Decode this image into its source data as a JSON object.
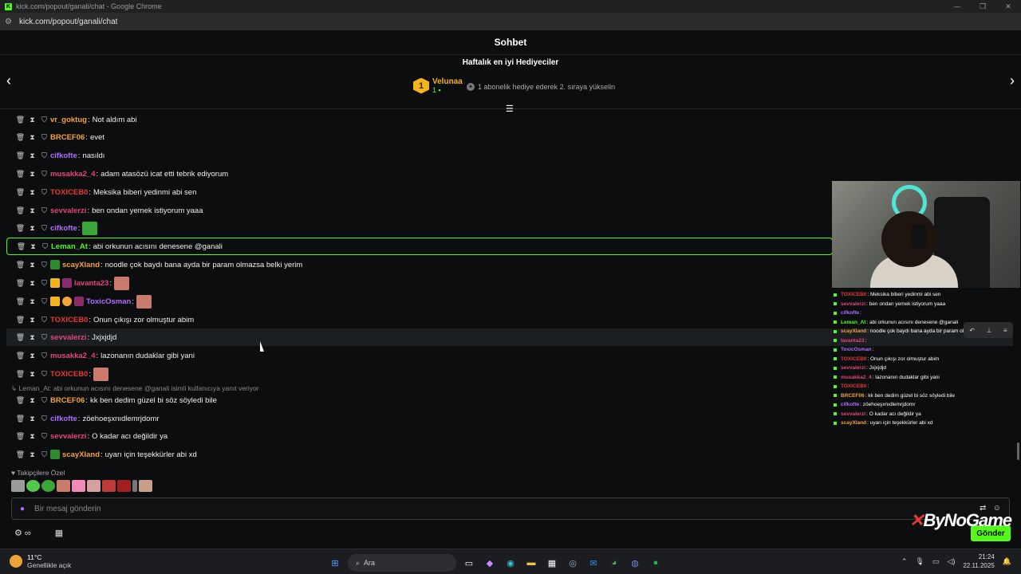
{
  "browser": {
    "title": "kick.com/popout/ganali/chat - Google Chrome",
    "url": "kick.com/popout/ganali/chat"
  },
  "header": {
    "title": "Sohbet"
  },
  "gifters": {
    "title": "Haftalık en iyi Hediyeciler",
    "top": {
      "rank": "1",
      "name": "Velunaa",
      "count": "1"
    },
    "hint": "1 abonelik hediye ederek 2. sıraya yükselin"
  },
  "messages": [
    {
      "user": "vr_goktug",
      "color": "#f3a33a",
      "text": "Not aldım abi"
    },
    {
      "user": "BRCEF06",
      "color": "#f3a33a",
      "text": "evet"
    },
    {
      "user": "cifkofte",
      "color": "#b36cff",
      "text": "nasıldı"
    },
    {
      "user": "musakka2_4",
      "color": "#e5457a",
      "text": "adam atasözü icat etti tebrik ediyorum"
    },
    {
      "user": "TOXICEB0",
      "color": "#e53935",
      "text": "Meksika biberi yedinmi abi sen"
    },
    {
      "user": "sevvalerzi",
      "color": "#e5457a",
      "text": "ben ondan yemek istiyorum yaaa"
    },
    {
      "user": "cifkofte",
      "color": "#b36cff",
      "text": ""
    },
    {
      "user": "Leman_At",
      "color": "#53fc18",
      "text": "abi orkunun acısını denesene @ganali"
    },
    {
      "user": "scayXland",
      "color": "#f3a33a",
      "text": "noodle çok baydı bana ayda bir param olmazsa belki yerim"
    },
    {
      "user": "lavanta23",
      "color": "#e5457a",
      "text": ""
    },
    {
      "user": "ToxicOsman",
      "color": "#b36cff",
      "text": ""
    },
    {
      "user": "TOXICEB0",
      "color": "#e53935",
      "text": "Onun çıkışı zor olmuştur abim"
    },
    {
      "user": "sevvalerzi",
      "color": "#e5457a",
      "text": "Jxjxjdjd"
    },
    {
      "user": "musakka2_4",
      "color": "#e5457a",
      "text": "lazonanın dudaklar gibi yani"
    },
    {
      "user": "TOXICEB0",
      "color": "#e53935",
      "text": ""
    },
    {
      "user": "BRCEF06",
      "color": "#f3a33a",
      "text": "kk ben dedim güzel bi söz söyledi bile"
    },
    {
      "user": "cifkofte",
      "color": "#b36cff",
      "text": "zöehoeşxnıdlemrjdomr"
    },
    {
      "user": "sevvalerzi",
      "color": "#e5457a",
      "text": "O kadar acı değildir ya"
    },
    {
      "user": "scayXland",
      "color": "#f3a33a",
      "text": "uyarı için teşekkürler abi xd"
    }
  ],
  "reply_context": "Leman_At: abi orkunun acısını denesene @ganali isimli kullanıcıya yanıt veriyor",
  "follower_emotes_label": "Takipçilere Özel",
  "composer": {
    "placeholder": "Bir mesaj gönderin",
    "send_label": "Gönder"
  },
  "overlay_chat": [
    {
      "user": "TOXICEB0",
      "color": "#e53935",
      "text": ": Meksika biberi yedinmi abi sen"
    },
    {
      "user": "sevvalerzi",
      "color": "#e5457a",
      "text": ": ben ondan yemek istiyorum yaaa"
    },
    {
      "user": "cifkofte",
      "color": "#b36cff",
      "text": ":"
    },
    {
      "user": "Leman_At",
      "color": "#53fc18",
      "text": ": abi orkunun acısını denesene @ganali"
    },
    {
      "user": "scayXland",
      "color": "#f3a33a",
      "text": ": noodle çok baydı bana ayda bir param olmazsa belki yerim"
    },
    {
      "user": "lavanta23",
      "color": "#e5457a",
      "text": ":"
    },
    {
      "user": "ToxicOsman",
      "color": "#b36cff",
      "text": ":"
    },
    {
      "user": "TOXICEB0",
      "color": "#e53935",
      "text": ": Onun çıkışı zor olmuştur abim"
    },
    {
      "user": "sevvalerzi",
      "color": "#e5457a",
      "text": ": Jxjxjdjd"
    },
    {
      "user": "musakka2_4",
      "color": "#e5457a",
      "text": ": lazonanın dudaklar gibi yani"
    },
    {
      "user": "TOXICEB0",
      "color": "#e53935",
      "text": ":"
    },
    {
      "user": "BRCEF06",
      "color": "#f3a33a",
      "text": ": kk ben dedim güzel bi söz söyledi bile"
    },
    {
      "user": "cifkofte",
      "color": "#b36cff",
      "text": ": zöehoeşxnıdlemrjdomr"
    },
    {
      "user": "sevvalerzi",
      "color": "#e5457a",
      "text": ": O kadar acı değildir ya"
    },
    {
      "user": "scayXland",
      "color": "#f3a33a",
      "text": ": uyarı için teşekkürler abi xd"
    }
  ],
  "watermark": {
    "brand": "ByNoGame"
  },
  "taskbar": {
    "weather_temp": "11°C",
    "weather_cond": "Genellikle açık",
    "search_placeholder": "Ara",
    "time": "21:24",
    "date": "22.11.2025"
  }
}
